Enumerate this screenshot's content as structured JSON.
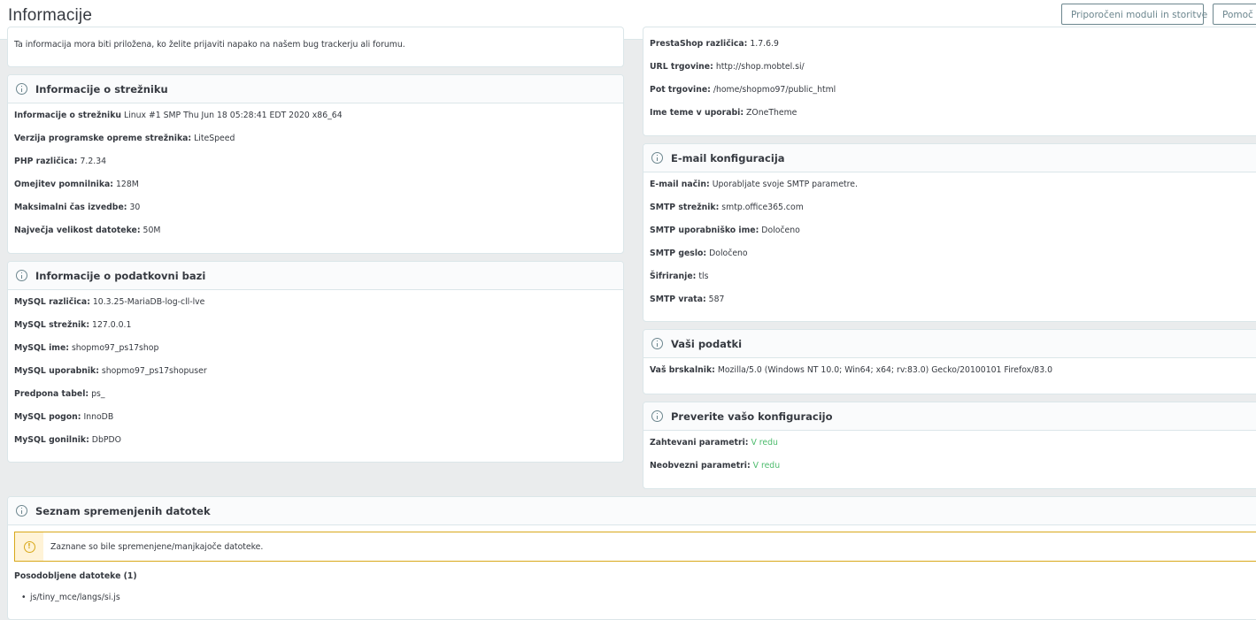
{
  "header": {
    "title": "Informacije",
    "buttons": [
      "Priporočeni moduli in storitve",
      "Pomoč"
    ]
  },
  "intro": {
    "text": "Ta informacija mora biti priložena, ko želite prijaviti napako na našem bug trackerju ali forumu."
  },
  "server": {
    "title": "Informacije o strežniku",
    "rows": [
      {
        "label": "Informacije o strežniku",
        "value": "Linux #1 SMP Thu Jun 18 05:28:41 EDT 2020 x86_64"
      },
      {
        "label": "Verzija programske opreme strežnika:",
        "value": "LiteSpeed"
      },
      {
        "label": "PHP različica:",
        "value": "7.2.34"
      },
      {
        "label": "Omejitev pomnilnika:",
        "value": "128M"
      },
      {
        "label": "Maksimalni čas izvedbe:",
        "value": "30"
      },
      {
        "label": "Največja velikost datoteke:",
        "value": "50M"
      }
    ]
  },
  "database": {
    "title": "Informacije o podatkovni bazi",
    "rows": [
      {
        "label": "MySQL različica:",
        "value": "10.3.25-MariaDB-log-cll-lve"
      },
      {
        "label": "MySQL strežnik:",
        "value": "127.0.0.1"
      },
      {
        "label": "MySQL ime:",
        "value": "shopmo97_ps17shop"
      },
      {
        "label": "MySQL uporabnik:",
        "value": "shopmo97_ps17shopuser"
      },
      {
        "label": "Predpona tabel:",
        "value": "ps_"
      },
      {
        "label": "MySQL pogon:",
        "value": "InnoDB"
      },
      {
        "label": "MySQL gonilnik:",
        "value": "DbPDO"
      }
    ]
  },
  "store": {
    "rows": [
      {
        "label": "PrestaShop različica:",
        "value": "1.7.6.9"
      },
      {
        "label": "URL trgovine:",
        "value": "http://shop.mobtel.si/"
      },
      {
        "label": "Pot trgovine:",
        "value": "/home/shopmo97/public_html"
      },
      {
        "label": "Ime teme v uporabi:",
        "value": "ZOneTheme"
      }
    ]
  },
  "email": {
    "title": "E-mail konfiguracija",
    "rows": [
      {
        "label": "E-mail način:",
        "value": "Uporabljate svoje SMTP parametre."
      },
      {
        "label": "SMTP strežnik:",
        "value": "smtp.office365.com"
      },
      {
        "label": "SMTP uporabniško ime:",
        "value": "Določeno"
      },
      {
        "label": "SMTP geslo:",
        "value": "Določeno"
      },
      {
        "label": "Šifriranje:",
        "value": "tls"
      },
      {
        "label": "SMTP vrata:",
        "value": "587"
      }
    ]
  },
  "yourdata": {
    "title": "Vaši podatki",
    "rows": [
      {
        "label": "Vaš brskalnik:",
        "value": "Mozilla/5.0 (Windows NT 10.0; Win64; x64; rv:83.0) Gecko/20100101 Firefox/83.0"
      }
    ]
  },
  "check": {
    "title": "Preverite vašo konfiguracijo",
    "rows": [
      {
        "label": "Zahtevani parametri:",
        "value": "V redu"
      },
      {
        "label": "Neobvezni parametri:",
        "value": "V redu"
      }
    ]
  },
  "changed": {
    "title": "Seznam spremenjenih datotek",
    "warning": "Zaznane so bile spremenjene/manjkajoče datoteke.",
    "updated_heading": "Posodobljene datoteke (1)",
    "files": [
      "js/tiny_mce/langs/si.js"
    ]
  },
  "colors": {
    "ok": "#4cbb6c",
    "warning": "#d8a81a",
    "border": "#dbe6e9",
    "background": "#eaeced"
  }
}
